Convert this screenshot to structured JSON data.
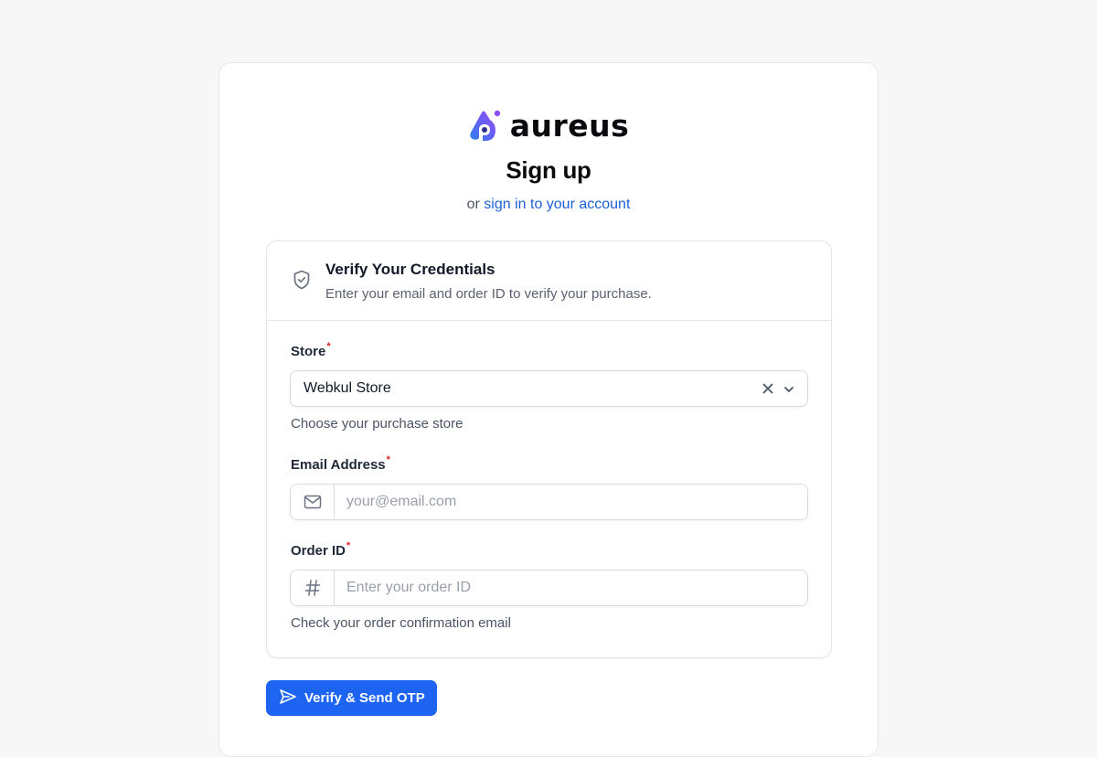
{
  "brand": {
    "name": "aureus",
    "accent_colors": [
      "#2f7ff0",
      "#7a4ff5",
      "#a04fe6"
    ]
  },
  "header": {
    "title": "Sign up",
    "alt_prefix": "or",
    "alt_link": "sign in to your account"
  },
  "panel": {
    "icon": "shield-check-icon",
    "title": "Verify Your Credentials",
    "description": "Enter your email and order ID to verify your purchase."
  },
  "form": {
    "store": {
      "label": "Store",
      "required_mark": "*",
      "value": "Webkul Store",
      "hint": "Choose your purchase store"
    },
    "email": {
      "label": "Email Address",
      "required_mark": "*",
      "placeholder": "your@email.com",
      "value": "",
      "icon": "mail-icon"
    },
    "order_id": {
      "label": "Order ID",
      "required_mark": "*",
      "placeholder": "Enter your order ID",
      "value": "",
      "icon": "hash-icon",
      "hint": "Check your order confirmation email"
    }
  },
  "actions": {
    "submit_label": "Verify & Send OTP",
    "submit_icon": "send-icon",
    "primary_color": "#1d64f2"
  }
}
